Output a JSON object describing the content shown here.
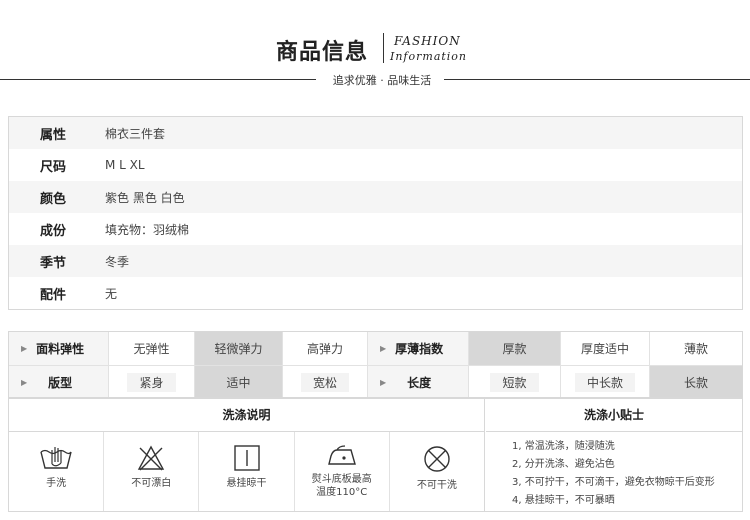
{
  "header": {
    "title": "商品信息",
    "fashion": "FASHION",
    "information": "Information",
    "subtitle": "追求优雅 · 品味生活"
  },
  "attributes": [
    {
      "key": "属性",
      "value": "棉衣三件套"
    },
    {
      "key": "尺码",
      "value": "M  L  XL"
    },
    {
      "key": "颜色",
      "value": "紫色  黑色  白色"
    },
    {
      "key": "成份",
      "value": "填充物：羽绒棉"
    },
    {
      "key": "季节",
      "value": "冬季"
    },
    {
      "key": "配件",
      "value": "无"
    }
  ],
  "features": {
    "elasticity": {
      "label": "面料弹性",
      "options": [
        "无弹性",
        "轻微弹力",
        "高弹力"
      ],
      "selected": "轻微弹力"
    },
    "thickness": {
      "label": "厚薄指数",
      "options": [
        "厚款",
        "厚度适中",
        "薄款"
      ],
      "selected": "厚款"
    },
    "fit": {
      "label": "版型",
      "options": [
        "紧身",
        "适中",
        "宽松"
      ],
      "selected": "适中"
    },
    "length": {
      "label": "长度",
      "options": [
        "短款",
        "中长款",
        "长款"
      ],
      "selected": "长款"
    }
  },
  "wash": {
    "title": "洗涤说明",
    "icons": [
      {
        "icon": "hand-wash-icon",
        "label": "手洗"
      },
      {
        "icon": "no-bleach-icon",
        "label": "不可漂白"
      },
      {
        "icon": "hang-dry-icon",
        "label": "悬挂晾干"
      },
      {
        "icon": "iron-icon",
        "label": "熨斗底板最高",
        "label2": "温度110°C"
      },
      {
        "icon": "no-tumble-dry-icon",
        "label": "不可干洗"
      }
    ]
  },
  "tips": {
    "title": "洗涤小贴士",
    "items": [
      "1, 常温洗涤，随浸随洗",
      "2, 分开洗涤、避免沾色",
      "3, 不可拧干，不可滴干，避免衣物晾干后变形",
      "4, 悬挂晾干，不可暴晒"
    ]
  },
  "colors": {
    "selected_bg": "#d7d7d7",
    "label_bg": "#f5f5f5",
    "border": "#d8d8d8"
  }
}
